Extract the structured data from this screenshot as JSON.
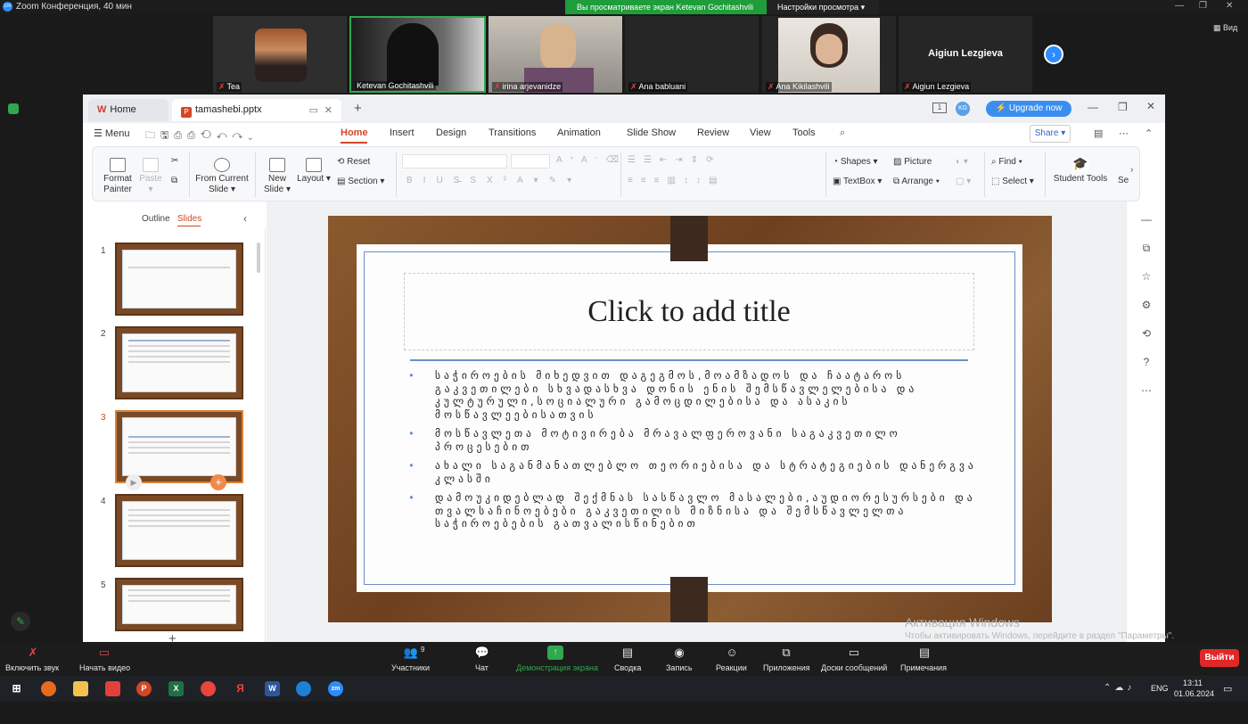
{
  "zoom": {
    "window_title": "Zoom Конференция, 40 мин",
    "share_banner": "Вы просматриваете экран Ketevan Gochitashvili",
    "view_settings": "Настройки просмотра",
    "view_label": "Вид",
    "participants_gallery": [
      "Tea",
      "Ketevan Gochitashvili",
      "irina arjevanidze",
      "Ana babluani",
      "Ana Kikilashvili",
      "Aigiun Lezgieva"
    ],
    "highlight_name": "Aigiun Lezgieva",
    "bottom": {
      "audio": "Включить звук",
      "video": "Начать видео",
      "participants": "Участники",
      "participants_count": "9",
      "chat": "Чат",
      "share": "Демонстрация экрана",
      "summary": "Сводка",
      "record": "Запись",
      "reactions": "Реакции",
      "apps": "Приложения",
      "whiteboards": "Доски сообщений",
      "notes": "Примечания",
      "exit": "Выйти"
    }
  },
  "wps": {
    "tabs": {
      "home": "Home",
      "file": "tamashebi.pptx"
    },
    "upgrade": "Upgrade now",
    "avatar": "KG",
    "menu": "Menu",
    "ribbon_tabs": [
      "Home",
      "Insert",
      "Design",
      "Transitions",
      "Animation",
      "Slide Show",
      "Review",
      "View",
      "Tools"
    ],
    "share": "Share",
    "ribbon": {
      "format_painter": "Format Painter",
      "paste": "Paste",
      "from_current": "From Current Slide",
      "new_slide": "New Slide",
      "layout": "Layout",
      "reset": "Reset",
      "section": "Section",
      "shapes": "Shapes",
      "picture": "Picture",
      "textbox": "TextBox",
      "arrange": "Arrange",
      "find": "Find",
      "select": "Select",
      "student_tools": "Student Tools",
      "se": "Se"
    },
    "pane": {
      "outline": "Outline",
      "slides": "Slides"
    },
    "thumbs": [
      "1",
      "2",
      "3",
      "4",
      "5"
    ],
    "slide": {
      "title": "Click to add title",
      "bullets": [
        "საჭიროების მიხედვით დაგეგმოს,მოამზადოს და ჩაატაროს გაკვეთილები სხვადასხვა დონის ენის შემსწავლელებისა და კულტურული,სოციალური გამოცდილებისა და ასაკის მოსწავლეებისათვის",
        "მოსწავლეთა მოტივირება მრავალფეროვანი საგაკვეთილო პროცესებით",
        "ახალი საგანმანათლებლო თეორიებისა და სტრატეგიების დანერგვა კლასში",
        "დამოუკიდებლად შექმნას სასწავლო მასალები,აუდიორესურსები და თვალსაჩინოებები გაკვეთილის მიზნისა და შემსწავლელთა საჭიროებების გათვალისწინებით"
      ]
    }
  },
  "windows": {
    "watermark_title": "Активация Windows",
    "watermark_text": "Чтобы активировать Windows, перейдите в раздел \"Параметры\".",
    "lang": "ENG",
    "time": "13:11",
    "date": "01.06.2024"
  }
}
